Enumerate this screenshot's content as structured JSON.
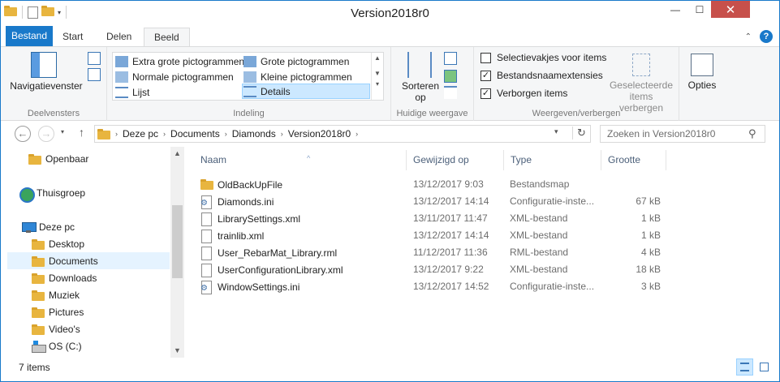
{
  "window": {
    "title": "Version2018r0"
  },
  "title_controls": {
    "minimize": "—",
    "maximize": "☐",
    "close": "✕"
  },
  "tabs": [
    "Bestand",
    "Start",
    "Delen",
    "Beeld"
  ],
  "active_tab": "Beeld",
  "ribbon": {
    "panes": {
      "label": "Deelvensters",
      "nav_pane_button": "Navigatievenster"
    },
    "layout": {
      "label": "Indeling",
      "items": [
        "Extra grote pictogrammen",
        "Grote pictogrammen",
        "Normale pictogrammen",
        "Kleine pictogrammen",
        "Lijst",
        "Details"
      ],
      "selected": "Details"
    },
    "current_view": {
      "label": "Huidige weergave",
      "sort_line1": "Sorteren",
      "sort_line2": "op"
    },
    "show_hide": {
      "label": "Weergeven/verbergen",
      "checkboxes": [
        {
          "label": "Selectievakjes voor items",
          "checked": false
        },
        {
          "label": "Bestandsnaamextensies",
          "checked": true
        },
        {
          "label": "Verborgen items",
          "checked": true
        }
      ],
      "hide_selected_line1": "Geselecteerde",
      "hide_selected_line2": "items verbergen"
    },
    "options": {
      "label": "Opties"
    }
  },
  "address": {
    "crumbs": [
      "Deze pc",
      "Documents",
      "Diamonds",
      "Version2018r0"
    ],
    "search_placeholder": "Zoeken in Version2018r0"
  },
  "nav_pane": {
    "items": [
      {
        "label": "Openbaar",
        "icon": "folder-icon"
      },
      {
        "label": "Thuisgroep",
        "icon": "homegroup-icon"
      },
      {
        "label": "Deze pc",
        "icon": "pc-icon"
      },
      {
        "label": "Desktop",
        "icon": "folder-icon"
      },
      {
        "label": "Documents",
        "icon": "folder-icon",
        "selected": true
      },
      {
        "label": "Downloads",
        "icon": "folder-icon"
      },
      {
        "label": "Muziek",
        "icon": "folder-icon"
      },
      {
        "label": "Pictures",
        "icon": "folder-icon"
      },
      {
        "label": "Video's",
        "icon": "folder-icon"
      },
      {
        "label": "OS (C:)",
        "icon": "drive-icon"
      }
    ]
  },
  "file_list": {
    "columns": [
      "Naam",
      "Gewijzigd op",
      "Type",
      "Grootte"
    ],
    "rows": [
      {
        "name": "OldBackUpFile",
        "date": "13/12/2017 9:03",
        "type": "Bestandsmap",
        "size": "",
        "icon": "folder-icon"
      },
      {
        "name": "Diamonds.ini",
        "date": "13/12/2017 14:14",
        "type": "Configuratie-inste...",
        "size": "67 kB",
        "icon": "settings-file-icon"
      },
      {
        "name": "LibrarySettings.xml",
        "date": "13/11/2017 11:47",
        "type": "XML-bestand",
        "size": "1 kB",
        "icon": "document-icon"
      },
      {
        "name": "trainlib.xml",
        "date": "13/12/2017 14:14",
        "type": "XML-bestand",
        "size": "1 kB",
        "icon": "document-icon"
      },
      {
        "name": "User_RebarMat_Library.rml",
        "date": "11/12/2017 11:36",
        "type": "RML-bestand",
        "size": "4 kB",
        "icon": "document-icon"
      },
      {
        "name": "UserConfigurationLibrary.xml",
        "date": "13/12/2017 9:22",
        "type": "XML-bestand",
        "size": "18 kB",
        "icon": "document-icon"
      },
      {
        "name": "WindowSettings.ini",
        "date": "13/12/2017 14:52",
        "type": "Configuratie-inste...",
        "size": "3 kB",
        "icon": "settings-file-icon"
      }
    ]
  },
  "status": {
    "count": "7 items"
  },
  "colors": {
    "accent": "#1979ca",
    "selection": "#cce8ff",
    "close": "#c7504b"
  }
}
